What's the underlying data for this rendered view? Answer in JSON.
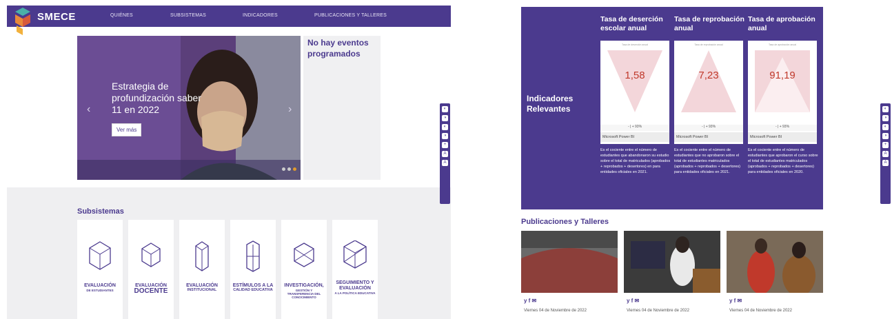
{
  "header": {
    "brand": "SMECE",
    "nav": [
      "QUIÉNES",
      "SUBSISTEMAS",
      "INDICADORES",
      "PUBLICACIONES Y TALLERES"
    ]
  },
  "hero": {
    "title": "Estrategia de profundización saber 11 en 2022",
    "button": "Ver más",
    "prev": "‹",
    "next": "›"
  },
  "events": {
    "title": "No hay eventos programados"
  },
  "subsystems": {
    "title": "Subsistemas",
    "cards": [
      {
        "main": "EVALUACIÓN",
        "sub": "DE ESTUDIANTES"
      },
      {
        "main": "EVALUACIÓN",
        "sub": "DOCENTE"
      },
      {
        "main": "EVALUACIÓN",
        "sub": "INSTITUCIONAL"
      },
      {
        "main": "ESTÍMULOS A LA",
        "sub": "CALIDAD EDUCATIVA"
      },
      {
        "main": "INVESTIGACIÓN,",
        "sub": "GESTIÓN Y TRANSFERENCIA DEL CONOCIMIENTO"
      },
      {
        "main": "SEGUIMIENTO Y EVALUACIÓN",
        "sub": "A LA POLÍTICA EDUCATIVA"
      }
    ]
  },
  "accessibility": {
    "buttons": [
      "◐",
      "◑",
      "◐",
      "◑",
      "+",
      "A",
      "A"
    ]
  },
  "indicators": {
    "heading": "Indicadores Relevantes",
    "columns": [
      {
        "title": "Tasa de deserción escolar anual",
        "value": "1,58",
        "caption": "Tasa de deserción anual",
        "zoom": "- | + 93%",
        "footer": "Microsoft Power BI",
        "description": "Es el cociente entre el número de estudiantes que abandonaron su estudio sobre el total de matriculados (aprobados + reprobados + desertores) en para entidades oficiales en 2021."
      },
      {
        "title": "Tasa de reprobación anual",
        "value": "7,23",
        "caption": "Tasa de reprobación anual",
        "zoom": "- | + 93%",
        "footer": "Microsoft Power BI",
        "description": "Es el cociente entre el número de estudiantes que no aprobaron sobre el total de estudiantes matriculados (aprobados + reprobados + desertores) para entidades oficiales en 2021."
      },
      {
        "title": "Tasa de aprobación anual",
        "value": "91,19",
        "caption": "Tasa de aprobación anual",
        "zoom": "- | + 93%",
        "footer": "Microsoft Power BI",
        "description": "Es el cociente entre el número de estudiantes que aprobaron el curso sobre el total de estudiantes matriculados (aprobados + reprobados + desertores) para entidades oficiales en 2020."
      }
    ]
  },
  "publications": {
    "title": "Publicaciones y Talleres",
    "items": [
      {
        "social": "y f ✉",
        "date": "Viernes 04 de Noviembre de 2022"
      },
      {
        "social": "y f ✉",
        "date": "Viernes 04 de Noviembre de 2022"
      },
      {
        "social": "y f ✉",
        "date": "Viernes 04 de Noviembre de 2022"
      }
    ]
  },
  "colors": {
    "primary": "#4b3a8e",
    "background": "#efeff1",
    "accent": "#c0392b"
  }
}
